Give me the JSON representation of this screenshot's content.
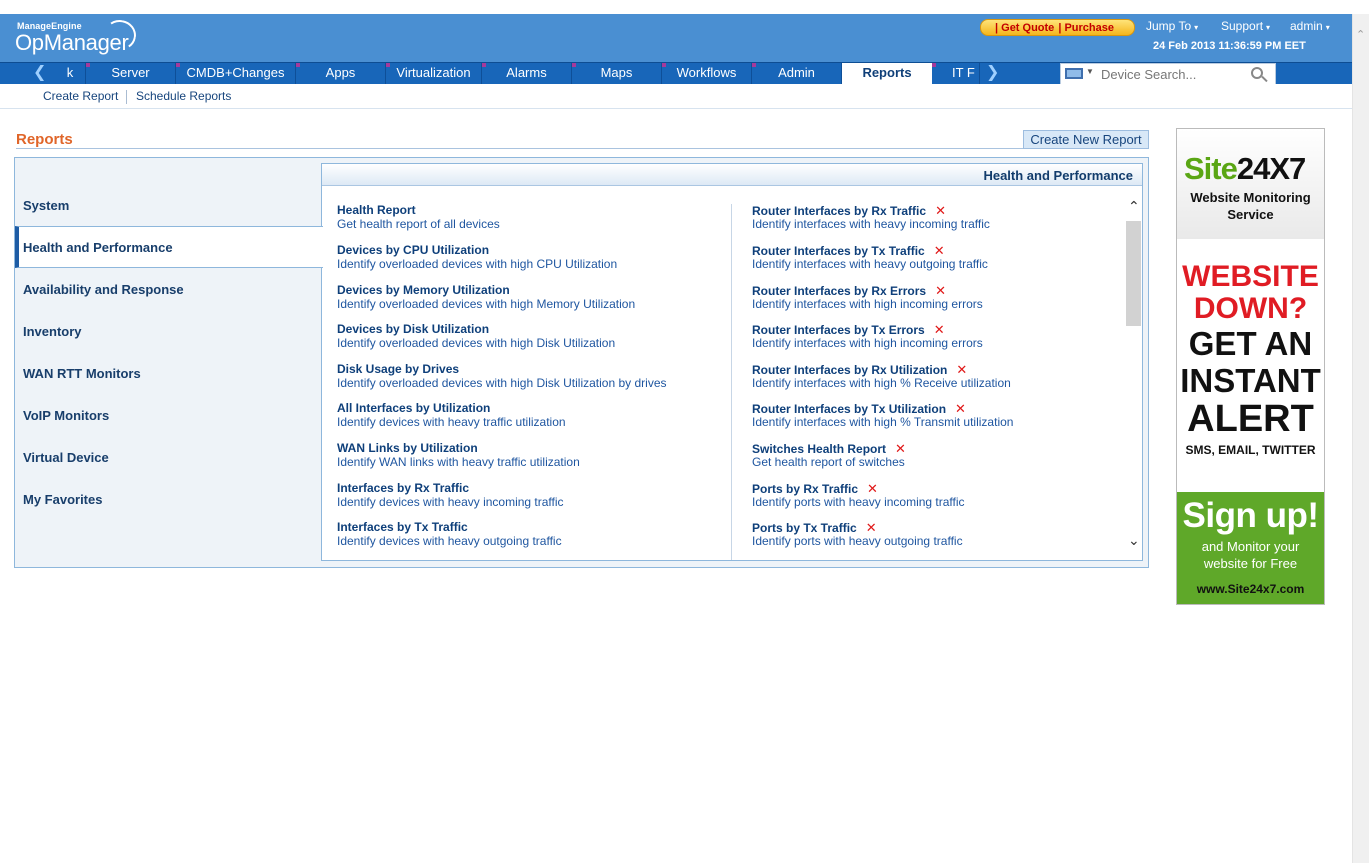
{
  "header": {
    "brand_small": "ManageEngine",
    "brand_name": "OpManager",
    "get_quote": "| Get Quote",
    "purchase": "| Purchase",
    "jump_to": "Jump To",
    "support": "Support",
    "user": "admin",
    "datetime": "24 Feb 2013 11:36:59 PM EET"
  },
  "nav": {
    "tabs": [
      {
        "label": "k"
      },
      {
        "label": "Server"
      },
      {
        "label": "CMDB+Changes"
      },
      {
        "label": "Apps"
      },
      {
        "label": "Virtualization"
      },
      {
        "label": "Alarms"
      },
      {
        "label": "Maps"
      },
      {
        "label": "Workflows"
      },
      {
        "label": "Admin"
      },
      {
        "label": "Reports"
      },
      {
        "label": "IT F"
      }
    ],
    "active_tab": "Reports",
    "search_placeholder": "Device Search..."
  },
  "subbar": {
    "create_report": "Create Report",
    "schedule_reports": "Schedule Reports"
  },
  "page": {
    "title": "Reports",
    "create_new_report": "Create New Report"
  },
  "categories": [
    {
      "label": "System"
    },
    {
      "label": "Health and Performance"
    },
    {
      "label": "Availability and Response"
    },
    {
      "label": "Inventory"
    },
    {
      "label": "WAN RTT Monitors"
    },
    {
      "label": "VoIP Monitors"
    },
    {
      "label": "Virtual Device"
    },
    {
      "label": "My Favorites"
    }
  ],
  "active_category": "Health and Performance",
  "section_title": "Health and Performance",
  "reports_left": [
    {
      "title": "Health Report",
      "desc": "Get health report of all devices"
    },
    {
      "title": "Devices by CPU Utilization",
      "desc": "Identify overloaded devices with high CPU Utilization"
    },
    {
      "title": "Devices by Memory Utilization",
      "desc": "Identify overloaded devices with high Memory Utilization"
    },
    {
      "title": "Devices by Disk Utilization",
      "desc": "Identify overloaded devices with high Disk Utilization"
    },
    {
      "title": "Disk Usage by Drives",
      "desc": "Identify overloaded devices with high Disk Utilization by drives"
    },
    {
      "title": "All Interfaces by Utilization",
      "desc": "Identify devices with heavy traffic utilization"
    },
    {
      "title": "WAN Links by Utilization",
      "desc": "Identify WAN links with heavy traffic utilization"
    },
    {
      "title": "Interfaces by Rx Traffic",
      "desc": "Identify devices with heavy incoming traffic"
    },
    {
      "title": "Interfaces by Tx Traffic",
      "desc": "Identify devices with heavy outgoing traffic"
    }
  ],
  "reports_right": [
    {
      "title": "Router Interfaces by Rx Traffic",
      "desc": "Identify interfaces with heavy incoming traffic",
      "removable": "✕"
    },
    {
      "title": "Router Interfaces by Tx Traffic",
      "desc": "Identify interfaces with heavy outgoing traffic",
      "removable": "✕"
    },
    {
      "title": "Router Interfaces by Rx Errors",
      "desc": "Identify interfaces with high incoming errors",
      "removable": "✕"
    },
    {
      "title": "Router Interfaces by Tx Errors",
      "desc": "Identify interfaces with high incoming errors",
      "removable": "✕"
    },
    {
      "title": "Router Interfaces by Rx Utilization",
      "desc": "Identify interfaces with high % Receive utilization",
      "removable": "✕"
    },
    {
      "title": "Router Interfaces by Tx Utilization",
      "desc": "Identify interfaces with high % Transmit utilization",
      "removable": "✕"
    },
    {
      "title": "Switches Health Report",
      "desc": "Get health report of switches",
      "removable": "✕"
    },
    {
      "title": "Ports by Rx Traffic",
      "desc": "Identify ports with heavy incoming traffic",
      "removable": "✕"
    },
    {
      "title": "Ports by Tx Traffic",
      "desc": "Identify ports with heavy outgoing traffic",
      "removable": "✕"
    }
  ],
  "ad": {
    "logo_site": "Site",
    "logo_num": "24X7",
    "tagline_1": "Website Monitoring",
    "tagline_2": "Service",
    "line_1": "WEBSITE",
    "line_2": "DOWN?",
    "line_3": "GET AN",
    "line_4": "INSTANT",
    "line_5": "ALERT",
    "channels": "SMS, EMAIL, TWITTER",
    "cta": "Sign up!",
    "cta_sub_1": "and Monitor your",
    "cta_sub_2": "website for Free",
    "url": "www.Site24x7.com"
  },
  "colors": {
    "header_bg": "#4a8fd2",
    "nav_bg": "#1866b9",
    "title_orange": "#e0662a",
    "remove_red": "#e01818",
    "ad_green": "#5fa829"
  }
}
